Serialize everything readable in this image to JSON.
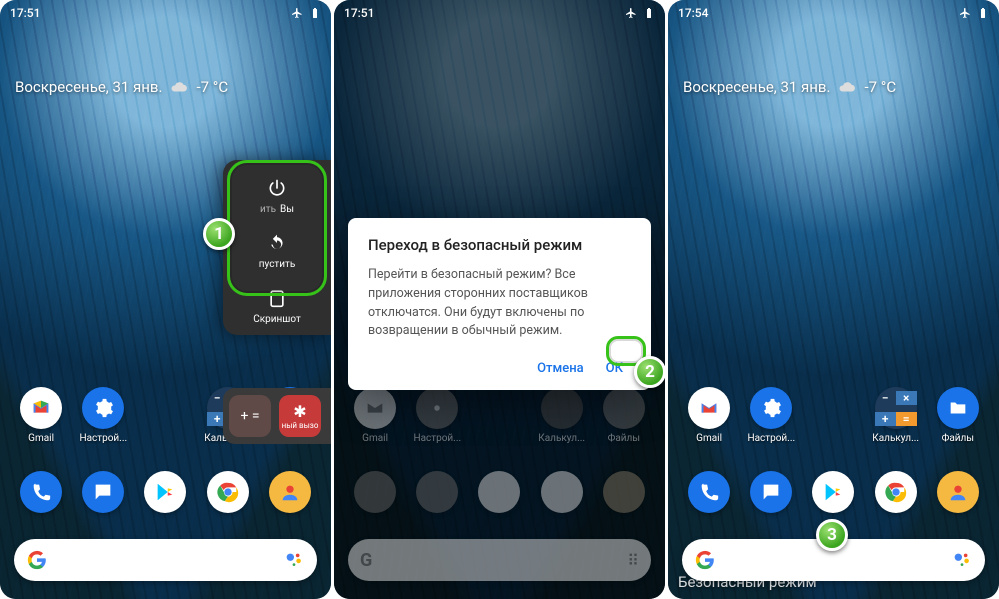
{
  "statusbar": {
    "time1": "17:51",
    "time2": "17:51",
    "time3": "17:54"
  },
  "date_widget": {
    "text": "Воскресенье, 31 янв.",
    "temp": "-7 °C"
  },
  "apps_row": [
    {
      "name": "gmail",
      "label": "Gmail"
    },
    {
      "name": "settings",
      "label": "Настрой..."
    },
    {
      "name": "spacer",
      "label": ""
    },
    {
      "name": "calc",
      "label": "Калькул..."
    },
    {
      "name": "files",
      "label": "Файлы"
    }
  ],
  "dock": [
    "phone",
    "messages",
    "play",
    "chrome",
    "camera"
  ],
  "power_menu": {
    "poweroff": "Выключить",
    "poweroff_short": "Вы",
    "restart": "Перезапустить",
    "restart_short": "пустить",
    "screenshot": "Скриншот",
    "emergency": "ный вызо"
  },
  "dialog": {
    "title": "Переход в безопасный режим",
    "body": "Перейти в безопасный режим? Все приложения сторонних поставщиков отключатся. Они будут включены по возвращении в обычный режим.",
    "cancel": "Отмена",
    "ok": "ОК"
  },
  "safe_mode_label": "Безопасный режим",
  "callouts": {
    "one": "1",
    "two": "2",
    "three": "3"
  }
}
